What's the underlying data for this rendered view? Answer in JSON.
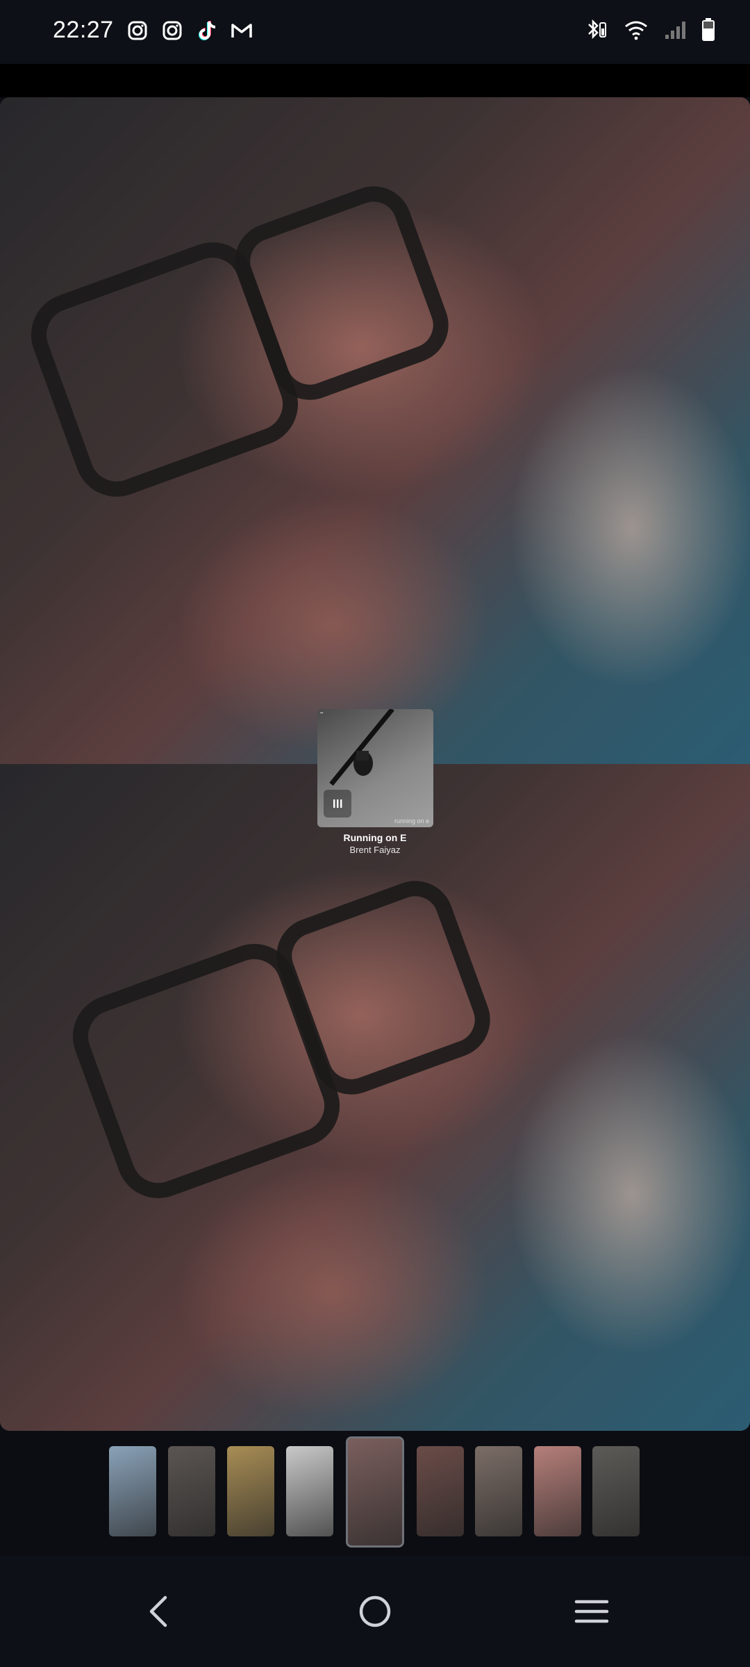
{
  "status_bar": {
    "time": "22:27",
    "notification_icons": [
      "instagram-icon",
      "instagram-icon",
      "tiktok-icon",
      "gmail-icon"
    ],
    "system_icons": [
      "bluetooth-icon",
      "wifi-icon",
      "cell-signal-icon",
      "battery-icon"
    ]
  },
  "music_sticker": {
    "song_title": "Running on E",
    "artist": "Brent Faiyaz",
    "cover_caption": "running on e",
    "state_icon": "pause-icon"
  },
  "thumbnails": [
    {
      "label": "story-1",
      "selected": false,
      "color": "#8aa2b8"
    },
    {
      "label": "story-2",
      "selected": false,
      "color": "#5b5552"
    },
    {
      "label": "story-3",
      "selected": false,
      "color": "#a88d55"
    },
    {
      "label": "story-4",
      "selected": false,
      "color": "#c9c9c9"
    },
    {
      "label": "story-5",
      "selected": true,
      "color": "#7a5f5d"
    },
    {
      "label": "story-6",
      "selected": false,
      "color": "#6a4c48"
    },
    {
      "label": "story-7",
      "selected": false,
      "color": "#7b6d66"
    },
    {
      "label": "story-8",
      "selected": false,
      "color": "#b67f7a"
    },
    {
      "label": "story-9",
      "selected": false,
      "color": "#5d5b57"
    }
  ],
  "nav_bar": {
    "buttons": [
      "back-icon",
      "home-icon",
      "recent-apps-icon"
    ]
  },
  "colors": {
    "background": "#0b0d12",
    "status_bar": "#0d1016",
    "selected_thumb_border": "#6f7278"
  }
}
